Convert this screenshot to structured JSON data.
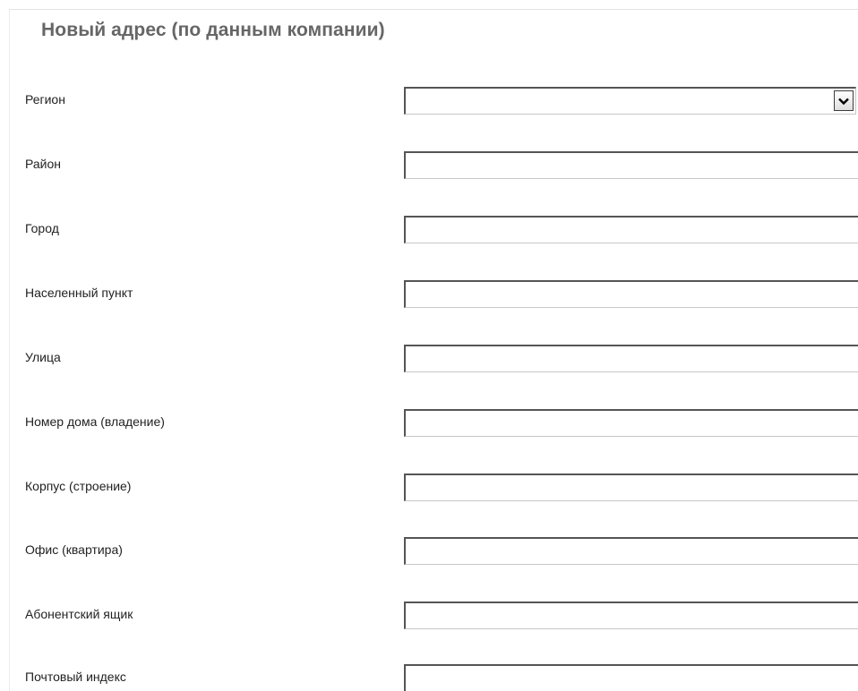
{
  "section": {
    "title": "Новый адрес (по данным компании)"
  },
  "form": {
    "region": {
      "label": "Регион",
      "value": ""
    },
    "district": {
      "label": "Район",
      "value": ""
    },
    "city": {
      "label": "Город",
      "value": ""
    },
    "settlement": {
      "label": "Населенный пункт",
      "value": ""
    },
    "street": {
      "label": "Улица",
      "value": ""
    },
    "house": {
      "label": "Номер дома (владение)",
      "value": ""
    },
    "building": {
      "label": "Корпус (строение)",
      "value": ""
    },
    "office": {
      "label": "Офис (квартира)",
      "value": ""
    },
    "po_box": {
      "label": "Абонентский ящик",
      "value": ""
    },
    "postal_code": {
      "label": "Почтовый индекс",
      "value": ""
    }
  },
  "icons": {
    "dropdown": "chevron-down-icon"
  },
  "colors": {
    "title": "#666666",
    "label": "#222222",
    "field_border_dark": "#555555",
    "field_border_light": "#c7c7c7",
    "background": "#ffffff"
  }
}
